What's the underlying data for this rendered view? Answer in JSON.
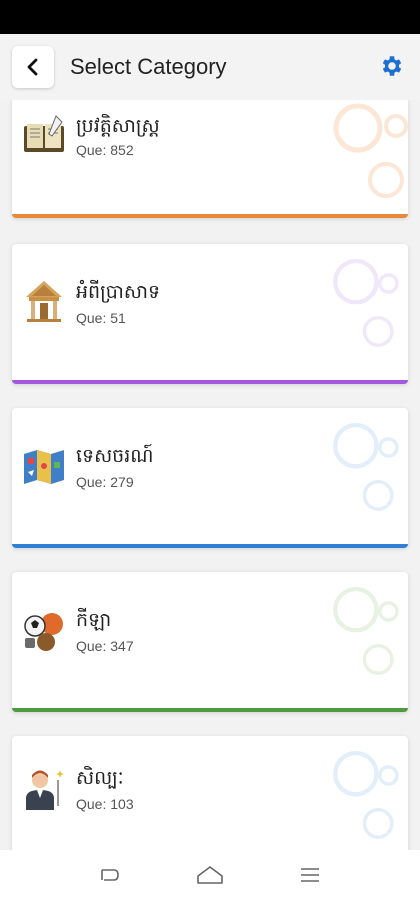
{
  "header": {
    "title": "Select Category"
  },
  "count_prefix": "Que: ",
  "categories": [
    {
      "name": "ប្រវត្តិសាស្ត្រ",
      "count": "Que: 852",
      "icon": "history-book-icon",
      "color": "#e8883a"
    },
    {
      "name": "អំពីប្រាសាទ",
      "count": "Que: 51",
      "icon": "temple-icon",
      "color": "#a259e0"
    },
    {
      "name": "ទេសចរណ៍",
      "count": "Que: 279",
      "icon": "tourism-map-icon",
      "color": "#2f7fd6"
    },
    {
      "name": "កីឡា",
      "count": "Que: 347",
      "icon": "sports-balls-icon",
      "color": "#4e9a3f"
    },
    {
      "name": "សិល្បៈ",
      "count": "Que: 103",
      "icon": "artist-icon",
      "color": "#e0b020"
    }
  ],
  "nav": {
    "back": "back-nav-icon",
    "home": "home-nav-icon",
    "menu": "menu-nav-icon"
  }
}
